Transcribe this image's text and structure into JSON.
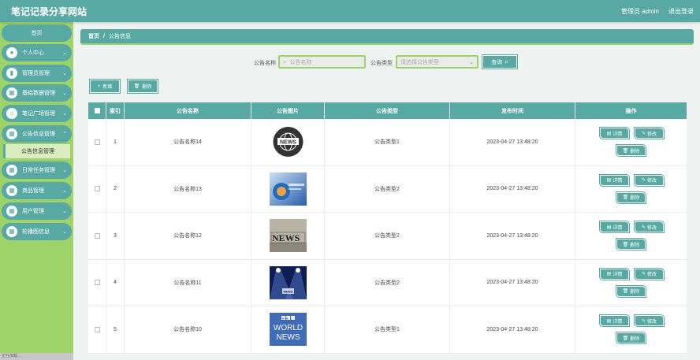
{
  "header": {
    "title": "笔记记录分享网站",
    "admin_label": "管理员 admin",
    "logout_label": "退出登录"
  },
  "sidebar": {
    "home": "首页",
    "items": [
      {
        "label": "个人中心",
        "icon": "user-icon"
      },
      {
        "label": "管理员管理",
        "icon": "chart-icon"
      },
      {
        "label": "基础数据管理",
        "icon": "grid-icon"
      },
      {
        "label": "笔记广场管理",
        "icon": "home-icon"
      },
      {
        "label": "公告信息管理",
        "icon": "grid-icon"
      },
      {
        "label": "日常任务管理",
        "icon": "grid-icon"
      },
      {
        "label": "商品管理",
        "icon": "grid-icon"
      },
      {
        "label": "用户管理",
        "icon": "grid-icon"
      },
      {
        "label": "轮播图信息",
        "icon": "grid-icon"
      }
    ],
    "submenu": "公告信息管理",
    "footer": "正在加载..."
  },
  "breadcrumb": {
    "home": "首页",
    "sep": "/",
    "current": "公告信息"
  },
  "search": {
    "name_label": "公告名称",
    "name_placeholder": "公告名称",
    "type_label": "公告类型",
    "type_placeholder": "请选择公告类型",
    "query_label": "查询"
  },
  "toolbar": {
    "add_label": "新增",
    "delete_label": "删除"
  },
  "table": {
    "columns": [
      "索引",
      "公告名称",
      "公告图片",
      "公告类型",
      "发布时间",
      "操作"
    ],
    "rows": [
      {
        "index": "1",
        "name": "公告名称14",
        "type": "公告类型1",
        "time": "2023-04-27 13:48:20",
        "image": "globe-news"
      },
      {
        "index": "2",
        "name": "公告名称13",
        "type": "公告类型2",
        "time": "2023-04-27 13:48:20",
        "image": "blue-news"
      },
      {
        "index": "3",
        "name": "公告名称12",
        "type": "公告类型2",
        "time": "2023-04-27 13:48:20",
        "image": "letters-news"
      },
      {
        "index": "4",
        "name": "公告名称11",
        "type": "公告类型2",
        "time": "2023-04-27 13:48:20",
        "image": "spotlight-news"
      },
      {
        "index": "5",
        "name": "公告名称10",
        "type": "公告类型1",
        "time": "2023-04-27 13:48:20",
        "image": "bbc-news"
      }
    ],
    "ops": {
      "detail": "详情",
      "edit": "修改",
      "delete": "删除"
    }
  },
  "images": {
    "news_text": "NEWS",
    "bbc_logo": "BBC",
    "bbc_line1": "WORLD",
    "bbc_line2": "NEWS"
  },
  "colors": {
    "accent": "#58a8a3",
    "sidebar": "#9ed36a"
  }
}
